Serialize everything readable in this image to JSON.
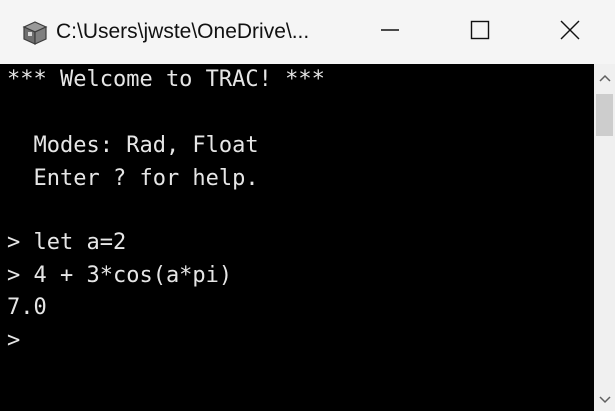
{
  "window": {
    "title": "C:\\Users\\jwste\\OneDrive\\...",
    "app_icon": "console-app-icon",
    "controls": {
      "minimize_icon": "minimize-icon",
      "maximize_icon": "maximize-icon",
      "close_icon": "close-icon"
    }
  },
  "console": {
    "lines": [
      "*** Welcome to TRAC! ***",
      "",
      "  Modes: Rad, Float",
      "  Enter ? for help.",
      "",
      "> let a=2",
      "> 4 + 3*cos(a*pi)",
      "7.0",
      ">"
    ]
  },
  "scrollbar": {
    "up_icon": "scroll-up-arrow-icon",
    "down_icon": "scroll-down-arrow-icon"
  },
  "colors": {
    "titlebar_bg": "#f5f5f5",
    "console_bg": "#000000",
    "console_text": "#e6e6e6",
    "scrollbar_bg": "#f0f0f0",
    "scroll_thumb": "#cdcdcd"
  }
}
